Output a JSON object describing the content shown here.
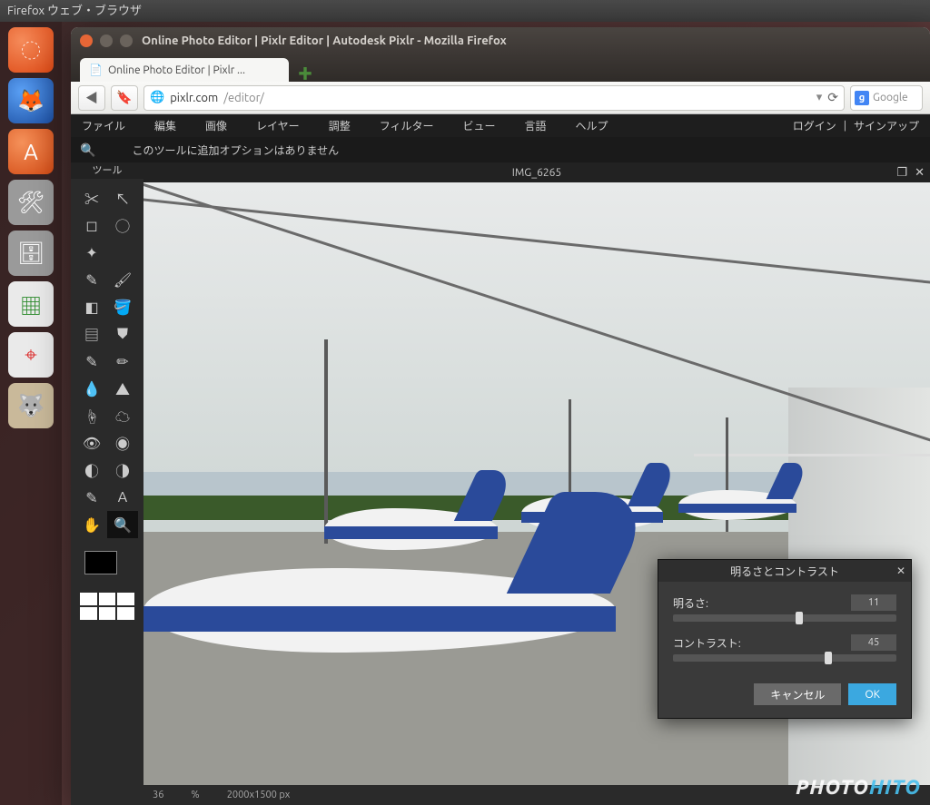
{
  "ubuntu": {
    "top_text": "Firefox ウェブ・ブラウザ"
  },
  "launcher": {
    "items": [
      {
        "name": "ubuntu-dash-icon",
        "glyph": "◌"
      },
      {
        "name": "firefox-icon",
        "glyph": "🦊"
      },
      {
        "name": "software-center-icon",
        "glyph": "A"
      },
      {
        "name": "settings-icon",
        "glyph": "🛠"
      },
      {
        "name": "files-icon",
        "glyph": "🗄"
      },
      {
        "name": "calc-icon",
        "glyph": "▦"
      },
      {
        "name": "target-icon",
        "glyph": "⌖"
      },
      {
        "name": "gimp-icon",
        "glyph": "🐺"
      }
    ]
  },
  "firefox": {
    "window_title": "Online Photo Editor | Pixlr Editor | Autodesk Pixlr - Mozilla Firefox",
    "tab_label": "Online Photo Editor | Pixlr ...",
    "url_readonly_prefix": "pixlr.com",
    "url_path": "/editor/",
    "search_placeholder": "Google"
  },
  "pixlr": {
    "menu": [
      "ファイル",
      "編集",
      "画像",
      "レイヤー",
      "調整",
      "フィルター",
      "ビュー",
      "言語",
      "ヘルプ"
    ],
    "login": "ログイン",
    "signup": "サインアップ",
    "divider": " | ",
    "options_text": "このツールに追加オプションはありません",
    "tool_panel_title": "ツール",
    "canvas_title": "IMG_6265",
    "status_zoom": "36",
    "status_dims": "2000x1500 px",
    "tools": [
      {
        "name": "crop-tool",
        "g": "✂"
      },
      {
        "name": "move-tool",
        "g": "↖"
      },
      {
        "name": "marquee-tool",
        "g": "◻"
      },
      {
        "name": "lasso-tool",
        "g": "◯"
      },
      {
        "name": "wand-tool",
        "g": "✦"
      },
      {
        "name": "spacer1",
        "g": ""
      },
      {
        "name": "pencil-tool",
        "g": "✎"
      },
      {
        "name": "brush-tool",
        "g": "🖌"
      },
      {
        "name": "eraser-tool",
        "g": "◧"
      },
      {
        "name": "bucket-tool",
        "g": "🪣"
      },
      {
        "name": "gradient-tool",
        "g": "▤"
      },
      {
        "name": "stamp-tool",
        "g": "⛊"
      },
      {
        "name": "color-replace-tool",
        "g": "✎"
      },
      {
        "name": "draw-tool",
        "g": "✏"
      },
      {
        "name": "blur-tool",
        "g": "💧"
      },
      {
        "name": "sharpen-tool",
        "g": "▲"
      },
      {
        "name": "smudge-tool",
        "g": "☝"
      },
      {
        "name": "sponge-tool",
        "g": "☁"
      },
      {
        "name": "redeye-tool",
        "g": "👁"
      },
      {
        "name": "spot-tool",
        "g": "◉"
      },
      {
        "name": "bloat-tool",
        "g": "◐"
      },
      {
        "name": "pinch-tool",
        "g": "◑"
      },
      {
        "name": "picker-tool",
        "g": "✎"
      },
      {
        "name": "type-tool",
        "g": "A"
      },
      {
        "name": "hand-tool",
        "g": "✋"
      },
      {
        "name": "zoom-tool",
        "g": "🔍"
      }
    ]
  },
  "dialog": {
    "title": "明るさとコントラスト",
    "brightness_label": "明るさ:",
    "brightness_value": "11",
    "brightness_pos_pct": 55,
    "contrast_label": "コントラスト:",
    "contrast_value": "45",
    "contrast_pos_pct": 68,
    "cancel": "キャンセル",
    "ok": "OK"
  },
  "watermark": {
    "part1": "PHOTO",
    "part2": "HITO"
  }
}
